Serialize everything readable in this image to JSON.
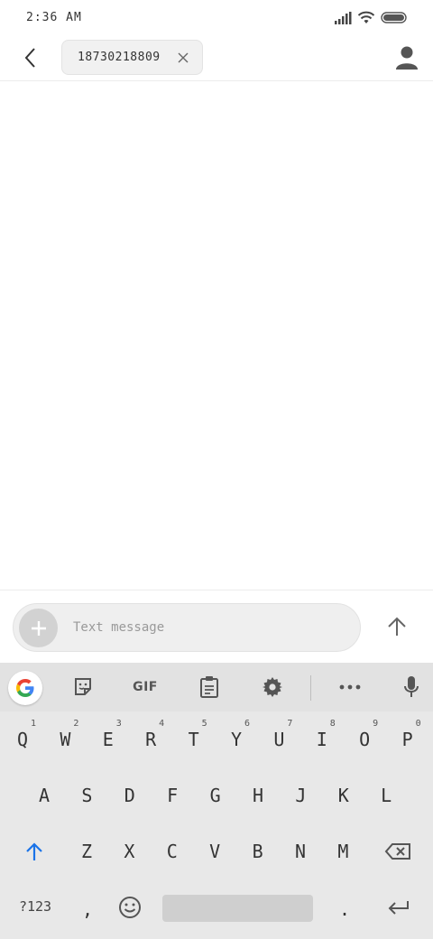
{
  "status_bar": {
    "time": "2:36 AM",
    "icons": [
      "signal-icon",
      "wifi-icon",
      "battery-icon"
    ]
  },
  "header": {
    "back_icon": "back-arrow-icon",
    "recipient": "18730218809",
    "clear_icon": "close-icon",
    "contact_icon": "person-icon"
  },
  "compose": {
    "attach_icon": "plus-icon",
    "placeholder": "Text message",
    "value": "",
    "send_icon": "up-arrow-icon"
  },
  "keyboard": {
    "toolbar": {
      "google_icon": "google-g-icon",
      "sticker_icon": "sticker-icon",
      "gif_label": "GIF",
      "clipboard_icon": "clipboard-icon",
      "settings_icon": "gear-icon",
      "more_icon": "more-horizontal-icon",
      "mic_icon": "microphone-icon"
    },
    "row1": [
      {
        "key": "Q",
        "hint": "1"
      },
      {
        "key": "W",
        "hint": "2"
      },
      {
        "key": "E",
        "hint": "3"
      },
      {
        "key": "R",
        "hint": "4"
      },
      {
        "key": "T",
        "hint": "5"
      },
      {
        "key": "Y",
        "hint": "6"
      },
      {
        "key": "U",
        "hint": "7"
      },
      {
        "key": "I",
        "hint": "8"
      },
      {
        "key": "O",
        "hint": "9"
      },
      {
        "key": "P",
        "hint": "0"
      }
    ],
    "row2": [
      "A",
      "S",
      "D",
      "F",
      "G",
      "H",
      "J",
      "K",
      "L"
    ],
    "row3": [
      "Z",
      "X",
      "C",
      "V",
      "B",
      "N",
      "M"
    ],
    "shift_icon": "shift-arrow-icon",
    "backspace_icon": "backspace-icon",
    "row4": {
      "symbols": "?123",
      "comma": ",",
      "emoji_icon": "emoji-icon",
      "period": ".",
      "enter_icon": "enter-icon"
    }
  },
  "colors": {
    "accent": "#1a73e8",
    "keyboard_bg": "#e8e8e8",
    "toolbar_bg": "#e2e2e2"
  }
}
